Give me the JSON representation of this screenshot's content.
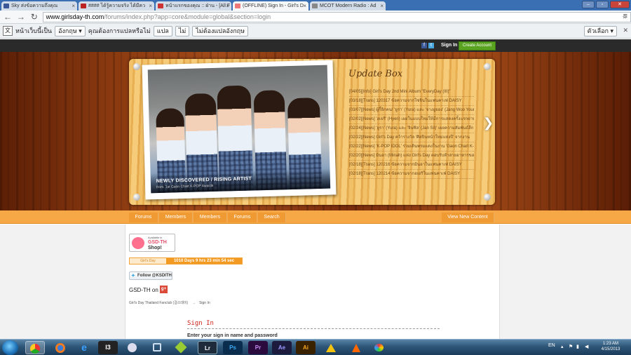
{
  "browser": {
    "tabs": [
      {
        "title": "Sky ส่งข้อความถึงคุณ"
      },
      {
        "title": "#### ได้รู้ความจริง ได้มีคว"
      },
      {
        "title": "หน้าแรกของคุณ :: ฝ่าน - [All F"
      },
      {
        "title": "(OFFLINE) Sign In - Girl's D"
      },
      {
        "title": "MCOT Modern Radio : Ad"
      }
    ],
    "url_domain": "www.girlsday-th.com",
    "url_path": "/forums/index.php?app=core&module=global&section=login"
  },
  "translate_bar": {
    "prefix": "หน้าเว็บนี้เป็น",
    "language": "อังกฤษ",
    "question": "คุณต้องการแปลหรือไม่",
    "translate_btn": "แปล",
    "no_btn": "ไม่",
    "never_btn": "ไม่ต้องแปลอังกฤษ",
    "options_btn": "ตัวเลือก"
  },
  "site_header": {
    "sign_in": "Sign In",
    "create_account": "Create Account"
  },
  "update_box": {
    "title": "Update Box",
    "items": [
      "[04/05][Info] Girl's Day 2nd Mini Album \"EveryDay (III)\"",
      "[03/18][Trans] 120317 ข้อความจากโซจินในแฟนคาเฟ่ DAISY",
      "[03/07][News] ผู้กี้อิกคน! 'ยูรา' (Yura) และ 'จางอูยอง' (Jang Woo Young)",
      "[02/02][News] 'ฮเยริ' (Hyeri) เผยในแบบใหม่ให้มีการแสดงครั้งแรกผ่าน",
      "[02/24][News] 'ยูรา' (Yura) และ 'จินซิล' (Jan Sil)' เผยความสัมพันธ์ลึก",
      "[02/22][News] Girl's Day คว้ารางวัล 'ศิลปินหน้าใหม่แห่งปี' จากงาน",
      "[02/22][News] 'K-POP IDOL' ร่วมเดินพรมแดงในงาน 'Gaon Chart K-POP'",
      "[02/20][News] มินอา (Minah) แห่ง Girl's Day ตอบรับท้าสายอาหารของ",
      "[02/18][Trans] 120216 ข้อความจากมินอาในแฟนคาเฟ่ DAISY",
      "[02/18][Trans] 120214 ข้อความจากฮเยริในแฟนคาเฟ่ DAISY"
    ]
  },
  "photo": {
    "caption_main": "NEWLY DISCOVERED / RISING ARTIST",
    "caption_sub": "from. 1st Gaon Chart K-POP Awards"
  },
  "nav": {
    "items": [
      "Forums",
      "Members",
      "Members",
      "Forums",
      "Search"
    ],
    "right": "View New Content"
  },
  "content": {
    "shop_available": "Available in",
    "shop_name": "GSD-TH",
    "shop_label": "Shop!",
    "day_label": "Girl's Day",
    "day_value": "1010 Days 9 hrs 23 min 54 sec",
    "follow": "Follow @KSDITH",
    "gsd_on": "GSD-TH  on",
    "gplus": "g+",
    "breadcrumb_root": "Girl's Day Thailand Fanclub (걸스데이)",
    "breadcrumb_arrow": "→",
    "breadcrumb_current": "Sign In",
    "signin_heading": "Sign In",
    "signin_sub": "Enter your sign in name and password"
  },
  "taskbar": {
    "apps": [
      "",
      "",
      "",
      "I3",
      "",
      "",
      "",
      "Lr",
      "Ps",
      "Pr",
      "Ae",
      "Ai",
      "",
      "",
      ""
    ],
    "language": "EN",
    "time": "1:23 AM",
    "date": "4/15/2013"
  }
}
